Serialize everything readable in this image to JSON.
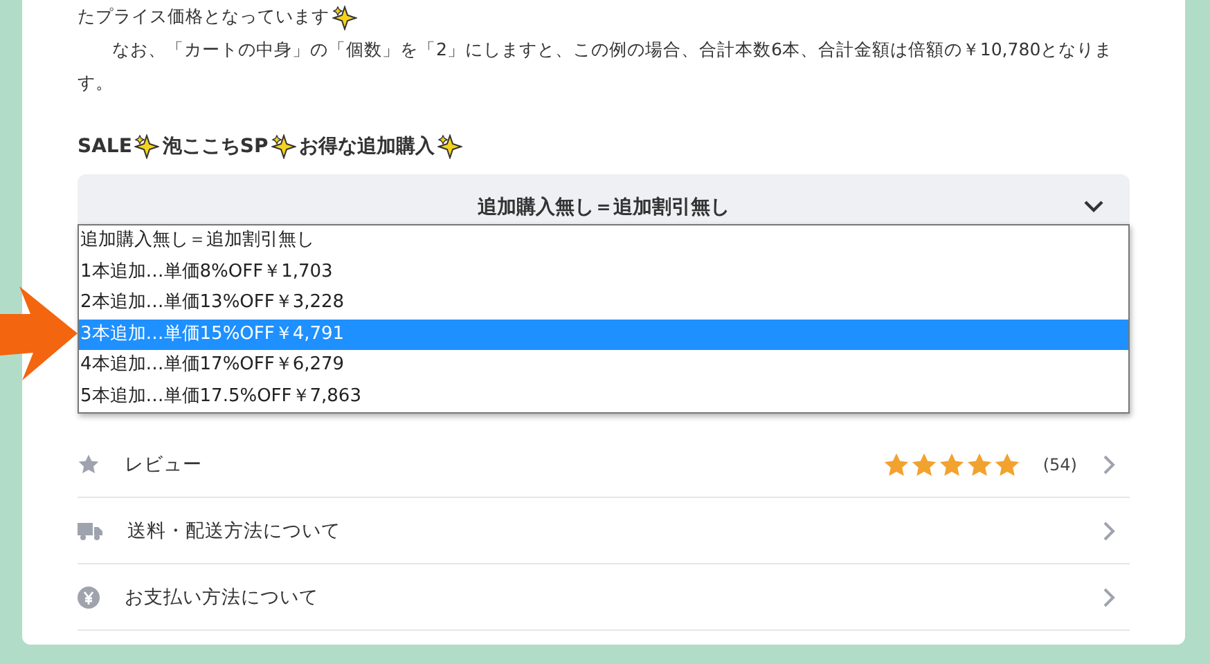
{
  "intro": {
    "lines": [
      {
        "text": "たプライス価格となっています",
        "sparkle": true
      },
      {
        "text": "なお、「カートの中身」の「個数」を「2」にしますと、この例の場合、合計本数6本、合計金額は倍額の￥10,780となります。",
        "sparkle": false
      }
    ]
  },
  "heading": [
    {
      "text": "SALE",
      "sparkle": true
    },
    {
      "text": "泡ここちSP",
      "sparkle": true
    },
    {
      "text": "お得な追加購入",
      "sparkle": true
    }
  ],
  "select": {
    "value": "追加購入無し＝追加割引無し",
    "expanded": true,
    "options": [
      {
        "label": "追加購入無し＝追加割引無し",
        "highlighted": false
      },
      {
        "label": "1本追加…単価8%OFF￥1,703",
        "highlighted": false
      },
      {
        "label": "2本追加…単価13%OFF￥3,228",
        "highlighted": false
      },
      {
        "label": "3本追加…単価15%OFF￥4,791",
        "highlighted": true
      },
      {
        "label": "4本追加…単価17%OFF￥6,279",
        "highlighted": false
      },
      {
        "label": "5本追加…単価17.5%OFF￥7,863",
        "highlighted": false
      }
    ]
  },
  "links": [
    {
      "kind": "review",
      "label": "レビュー",
      "stars": 5,
      "count": "(54)"
    },
    {
      "kind": "shipping",
      "label": "送料・配送方法について"
    },
    {
      "kind": "payment",
      "label": "お支払い方法について"
    }
  ]
}
